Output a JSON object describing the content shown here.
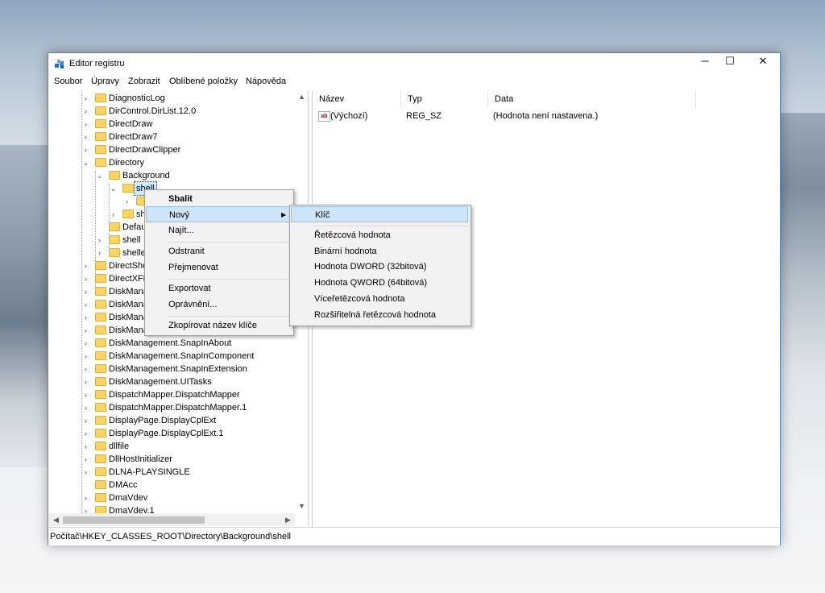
{
  "window": {
    "title": "Editor registru",
    "controls": {
      "minimize": "─",
      "maximize": "☐",
      "close": "✕"
    }
  },
  "menubar": [
    "Soubor",
    "Úpravy",
    "Zobrazit",
    "Oblíbené položky",
    "Nápověda"
  ],
  "tree": {
    "items": [
      "DiagnosticLog",
      "DirControl.DirList.12.0",
      "DirectDraw",
      "DirectDraw7",
      "DirectDrawClipper",
      "Directory",
      "Background",
      "shell",
      "",
      "sh",
      "Defau",
      "shell",
      "shelle",
      "DirectSho",
      "DirectXFil",
      "DiskMana",
      "DiskMana",
      "DiskMana",
      "DiskManag",
      "DiskManagement.SnapInAbout",
      "DiskManagement.SnapInComponent",
      "DiskManagement.SnapInExtension",
      "DiskManagement.UITasks",
      "DispatchMapper.DispatchMapper",
      "DispatchMapper.DispatchMapper.1",
      "DisplayPage.DisplayCplExt",
      "DisplayPage.DisplayCplExt.1",
      "dllfile",
      "DllHostInitializer",
      "DLNA-PLAYSINGLE",
      "DMAcc",
      "DmaVdev",
      "DmaVdev.1"
    ]
  },
  "list": {
    "columns": [
      "Název",
      "Typ",
      "Data"
    ],
    "rows": [
      {
        "name": "(Výchozí)",
        "type": "REG_SZ",
        "data": "(Hodnota není nastavena.)"
      }
    ]
  },
  "context_menu": {
    "items": [
      "Sbalit",
      "Nový",
      "Najít...",
      "Odstranit",
      "Přejmenovat",
      "Exportovat",
      "Oprávnění...",
      "Zkopírovat název klíče"
    ]
  },
  "submenu": {
    "items": [
      "Klíč",
      "Řetězcová hodnota",
      "Binární hodnota",
      "Hodnota DWORD (32bitová)",
      "Hodnota QWORD (64bitová)",
      "Víceřetězcová hodnota",
      "Rozšiřitelná řetězcová hodnota"
    ]
  },
  "statusbar": {
    "path": "Počítač\\HKEY_CLASSES_ROOT\\Directory\\Background\\shell"
  },
  "colors": {
    "accent_border": "#5b87b6",
    "folder": "#f7d469",
    "highlight": "#cfe5f7",
    "selection": "#cce8ff"
  }
}
